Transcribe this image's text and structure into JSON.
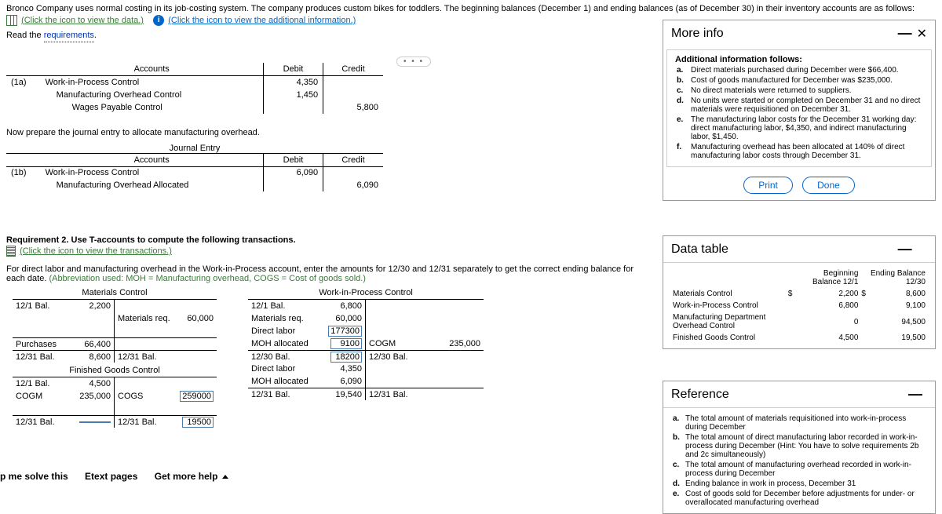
{
  "intro": {
    "line1": "Bronco Company uses normal costing in its job-costing system. The company produces custom bikes for toddlers. The beginning balances (December 1) and ending balances (as of December 30) in their inventory accounts are as follows:",
    "link1": "(Click the icon to view the data.)",
    "link2": "(Click the icon to view the additional information.)",
    "read": "Read the ",
    "requirements": "requirements"
  },
  "journal1": {
    "headers": {
      "accounts": "Accounts",
      "debit": "Debit",
      "credit": "Credit"
    },
    "label": "(1a)",
    "r1": {
      "acc": "Work-in-Process Control",
      "debit": "4,350"
    },
    "r2": {
      "acc": "Manufacturing Overhead Control",
      "debit": "1,450"
    },
    "r3": {
      "acc": "Wages Payable Control",
      "credit": "5,800"
    }
  },
  "prep": "Now prepare the journal entry to allocate manufacturing overhead.",
  "je_title": "Journal Entry",
  "journal2": {
    "headers": {
      "accounts": "Accounts",
      "debit": "Debit",
      "credit": "Credit"
    },
    "label": "(1b)",
    "r1": {
      "acc": "Work-in-Process Control",
      "debit": "6,090"
    },
    "r2": {
      "acc": "Manufacturing Overhead Allocated",
      "credit": "6,090"
    }
  },
  "req2": {
    "title": "Requirement 2. Use T-accounts to compute the following transactions.",
    "link": "(Click the icon to view the transactions.)",
    "desc": "For direct labor and manufacturing overhead in the Work-in-Process account, enter the amounts for 12/30 and 12/31 separately to get the correct ending balance for each date. ",
    "abbr": "(Abbreviation used: MOH = Manufacturing overhead, COGS = Cost of goods sold.)"
  },
  "tacct": {
    "mat": {
      "title": "Materials Control",
      "l1": {
        "lbl": "12/1 Bal.",
        "val": "2,200"
      },
      "r1": {
        "lbl": "Materials req.",
        "val": "60,000"
      },
      "l2": {
        "lbl": "Purchases",
        "val": "66,400"
      },
      "l3": {
        "lbl": "12/31 Bal.",
        "val": "8,600"
      },
      "r3": {
        "lbl": "12/31 Bal."
      }
    },
    "fg": {
      "title": "Finished Goods Control",
      "l1": {
        "lbl": "12/1 Bal.",
        "val": "4,500"
      },
      "l2": {
        "lbl": "COGM",
        "val": "235,000"
      },
      "r2": {
        "lbl": "COGS",
        "val": "259000"
      },
      "l3": {
        "lbl": "12/31 Bal."
      },
      "r3": {
        "lbl": "12/31 Bal.",
        "val": "19500"
      }
    },
    "wip": {
      "title": "Work-in-Process Control",
      "l1": {
        "lbl": "12/1 Bal.",
        "val": "6,800"
      },
      "l2": {
        "lbl": "Materials req.",
        "val": "60,000"
      },
      "l3": {
        "lbl": "Direct labor",
        "val": "177300"
      },
      "l4": {
        "lbl": "MOH allocated",
        "val": "9100"
      },
      "r4": {
        "lbl": "COGM",
        "val": "235,000"
      },
      "l5": {
        "lbl": "12/30 Bal.",
        "val": "18200"
      },
      "r5": {
        "lbl": "12/30 Bal."
      },
      "l6": {
        "lbl": "Direct labor",
        "val": "4,350"
      },
      "l7": {
        "lbl": "MOH allocated",
        "val": "6,090"
      },
      "l8": {
        "lbl": "12/31 Bal.",
        "val": "19,540"
      },
      "r8": {
        "lbl": "12/31 Bal."
      }
    }
  },
  "more_info": {
    "title": "More info",
    "lead": "Additional information follows:",
    "a": "Direct materials purchased during December were $66,400.",
    "b": "Cost of goods manufactured for December was $235,000.",
    "c": "No direct materials were returned to suppliers.",
    "d": "No units were started or completed on December 31 and no direct materials were requisitioned on December 31.",
    "e": "The manufacturing labor costs for the December 31 working day: direct manufacturing labor, $4,350, and indirect manufacturing labor, $1,450.",
    "f": "Manufacturing overhead has been allocated at 140% of direct manufacturing labor costs through December 31.",
    "print": "Print",
    "done": "Done"
  },
  "data_table": {
    "title": "Data table",
    "h1": "Beginning Balance 12/1",
    "h2": "Ending Balance 12/30",
    "r1": {
      "n": "Materials Control",
      "b": "2,200",
      "e": "8,600"
    },
    "r2": {
      "n": "Work-in-Process Control",
      "b": "6,800",
      "e": "9,100"
    },
    "r3": {
      "n": "Manufacturing Department Overhead Control",
      "b": "0",
      "e": "94,500"
    },
    "r4": {
      "n": "Finished Goods Control",
      "b": "4,500",
      "e": "19,500"
    },
    "cur": "$"
  },
  "reference": {
    "title": "Reference",
    "a": "The total amount of materials requisitioned into work-in-process during December",
    "b": "The total amount of direct manufacturing labor recorded in work-in-process during December (Hint: You have to solve requirements 2b and 2c simultaneously)",
    "c": "The total amount of manufacturing overhead recorded in work-in-process during December",
    "d": "Ending balance in work in process, December 31",
    "e": "Cost of goods sold for December before adjustments for under- or overallocated manufacturing overhead"
  },
  "footer": {
    "a": "p me solve this",
    "b": "Etext pages",
    "c": "Get more help"
  }
}
